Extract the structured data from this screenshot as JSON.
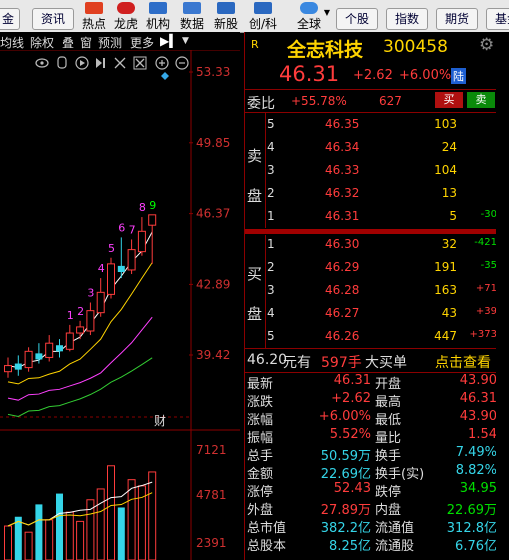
{
  "toolbar": {
    "top_partial": [
      "指金",
      "资讯",
      "热点",
      "龙虎",
      "机构",
      "数据",
      "新股",
      "创/科",
      "全球",
      "个股",
      "指数",
      "期货",
      "基金"
    ],
    "items": [
      {
        "label": "资讯",
        "type": "box"
      },
      {
        "label": "热点",
        "type": "icon"
      },
      {
        "label": "龙虎",
        "type": "icon"
      },
      {
        "label": "机构",
        "type": "icon"
      },
      {
        "label": "数据",
        "type": "icon"
      },
      {
        "label": "新股",
        "type": "icon"
      },
      {
        "label": "创/科",
        "type": "icon"
      },
      {
        "label": "全球",
        "type": "icon"
      },
      {
        "label": "个股",
        "type": "box"
      },
      {
        "label": "指数",
        "type": "box"
      },
      {
        "label": "期货",
        "type": "box"
      },
      {
        "label": "基金",
        "type": "box"
      }
    ],
    "left_label": "金"
  },
  "chart_toolbar": {
    "items": [
      "均线",
      "除权",
      "叠",
      "窗",
      "预测",
      "更多"
    ]
  },
  "chart_data": {
    "type": "candlestick",
    "price_ticks": [
      "53.33",
      "49.85",
      "46.37",
      "42.89",
      "39.42"
    ],
    "volume_ticks": [
      "7121",
      "4781",
      "2391"
    ],
    "markers": [
      "1",
      "2",
      "3",
      "4",
      "5",
      "6",
      "7",
      "8",
      "9"
    ],
    "annotation": "财",
    "candles": [
      {
        "o": 38.6,
        "c": 38.9,
        "h": 39.3,
        "l": 38.3
      },
      {
        "o": 39.0,
        "c": 38.7,
        "h": 39.4,
        "l": 38.4
      },
      {
        "o": 38.8,
        "c": 39.6,
        "h": 39.8,
        "l": 38.6
      },
      {
        "o": 39.5,
        "c": 39.2,
        "h": 40.0,
        "l": 39.0
      },
      {
        "o": 39.3,
        "c": 40.0,
        "h": 40.4,
        "l": 39.1
      },
      {
        "o": 39.9,
        "c": 39.6,
        "h": 40.2,
        "l": 39.3
      },
      {
        "o": 39.7,
        "c": 40.5,
        "h": 40.9,
        "l": 39.6
      },
      {
        "o": 40.5,
        "c": 40.8,
        "h": 41.1,
        "l": 40.2
      },
      {
        "o": 40.6,
        "c": 41.6,
        "h": 42.0,
        "l": 40.4
      },
      {
        "o": 41.5,
        "c": 42.5,
        "h": 43.2,
        "l": 41.3
      },
      {
        "o": 42.4,
        "c": 43.9,
        "h": 44.2,
        "l": 42.2
      },
      {
        "o": 43.8,
        "c": 43.5,
        "h": 45.2,
        "l": 43.2
      },
      {
        "o": 43.6,
        "c": 44.6,
        "h": 45.1,
        "l": 43.4
      },
      {
        "o": 44.5,
        "c": 45.5,
        "h": 46.2,
        "l": 44.3
      },
      {
        "o": 45.8,
        "c": 46.31,
        "h": 46.31,
        "l": 43.9
      }
    ],
    "volumes": [
      2200,
      2800,
      1800,
      3600,
      2600,
      4300,
      3100,
      2500,
      3900,
      4600,
      6100,
      3400,
      5200,
      4800,
      5700
    ]
  },
  "quote": {
    "badge": "R",
    "name": "全志科技",
    "code": "300458",
    "price": "46.31",
    "change": "+2.62",
    "change_pct": "+6.00%",
    "flag": "陆",
    "weibi_label": "委比",
    "weibi_value": "+55.78%",
    "weicha_value": "627",
    "buy_btn": "买",
    "sell_btn": "卖",
    "sell_label": [
      "卖",
      "盘"
    ],
    "buy_label": [
      "买",
      "盘"
    ],
    "sell_rows": [
      {
        "level": "5",
        "price": "46.35",
        "vol": "103",
        "delta": ""
      },
      {
        "level": "4",
        "price": "46.34",
        "vol": "24",
        "delta": ""
      },
      {
        "level": "3",
        "price": "46.33",
        "vol": "104",
        "delta": ""
      },
      {
        "level": "2",
        "price": "46.32",
        "vol": "13",
        "delta": ""
      },
      {
        "level": "1",
        "price": "46.31",
        "vol": "5",
        "delta": "-30"
      }
    ],
    "buy_rows": [
      {
        "level": "1",
        "price": "46.30",
        "vol": "32",
        "delta": "-421"
      },
      {
        "level": "2",
        "price": "46.29",
        "vol": "191",
        "delta": "-35"
      },
      {
        "level": "3",
        "price": "46.28",
        "vol": "163",
        "delta": "+71"
      },
      {
        "level": "4",
        "price": "46.27",
        "vol": "43",
        "delta": "+39"
      },
      {
        "level": "5",
        "price": "46.26",
        "vol": "447",
        "delta": "+373"
      }
    ],
    "trade_line": {
      "price": "46.20",
      "unit": "元有",
      "vol": "597手",
      "desc": "大买单",
      "link": "点击查看"
    },
    "stats": [
      {
        "l1": "最新",
        "v1": "46.31",
        "l2": "开盘",
        "v2": "43.90"
      },
      {
        "l1": "涨跌",
        "v1": "+2.62",
        "l2": "最高",
        "v2": "46.31"
      },
      {
        "l1": "涨幅",
        "v1": "+6.00%",
        "l2": "最低",
        "v2": "43.90"
      },
      {
        "l1": "振幅",
        "v1": "5.52%",
        "l2": "量比",
        "v2": "1.54"
      },
      {
        "l1": "总手",
        "v1": "50.59万",
        "l2": "换手",
        "v2": "7.49%"
      },
      {
        "l1": "金额",
        "v1": "22.69亿",
        "l2": "换手(实)",
        "v2": "8.82%"
      },
      {
        "l1": "涨停",
        "v1": "52.43",
        "l2": "跌停",
        "v2": "34.95"
      },
      {
        "l1": "外盘",
        "v1": "27.89万",
        "l2": "内盘",
        "v2": "22.69万"
      },
      {
        "l1": "总市值",
        "v1": "382.2亿",
        "l2": "流通值",
        "v2": "312.8亿"
      },
      {
        "l1": "总股本",
        "v1": "8.25亿",
        "l2": "流通股",
        "v2": "6.76亿"
      }
    ]
  }
}
